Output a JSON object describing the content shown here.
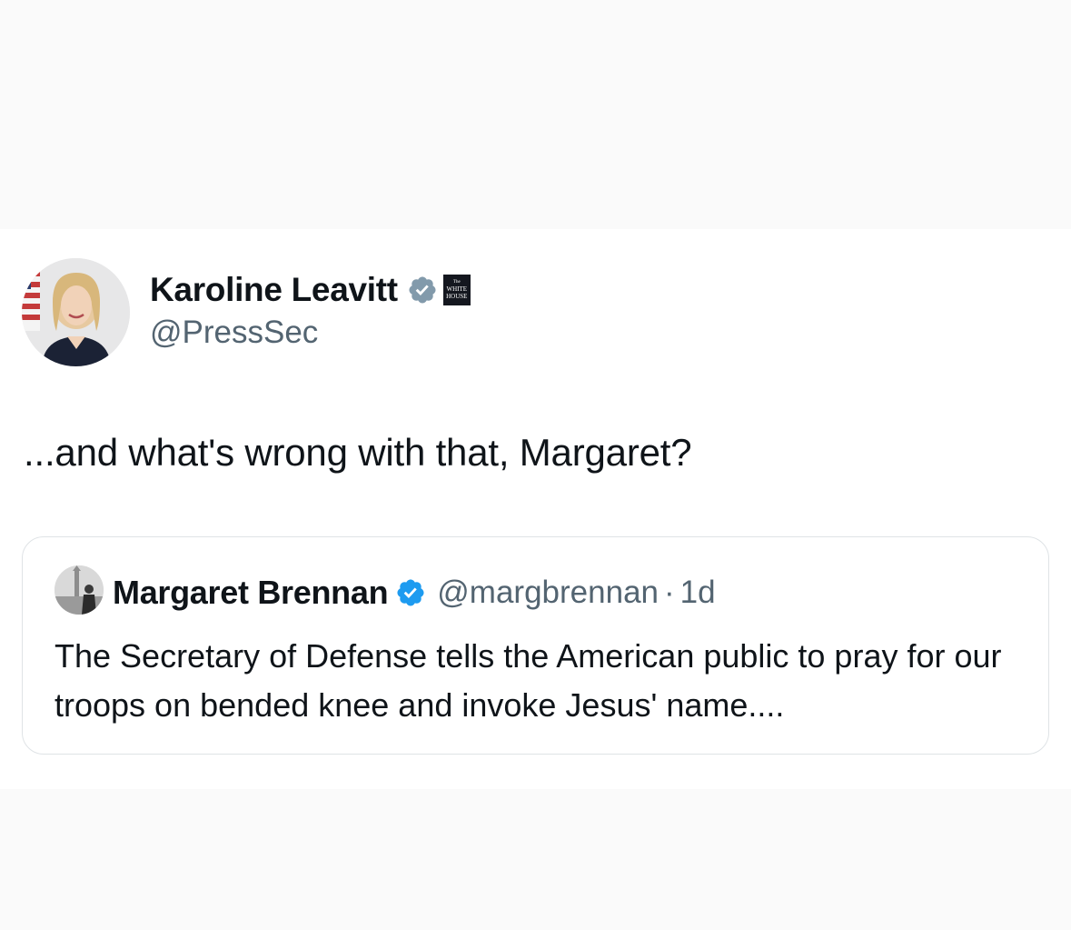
{
  "post": {
    "author": {
      "display_name": "Karoline Leavitt",
      "handle": "@PressSec",
      "verified_badge": "gray-verified-check-icon",
      "affiliation_badge": {
        "icon": "white-house-logo",
        "text_lines": [
          "The",
          "WHITE",
          "HOUSE"
        ]
      },
      "avatar": "avatar-karoline-leavitt"
    },
    "text": "...and what's wrong with that, Margaret?"
  },
  "quoted_post": {
    "author": {
      "display_name": "Margaret Brennan",
      "handle": "@margbrennan",
      "verified_badge": "blue-verified-check-icon",
      "avatar": "avatar-margaret-brennan"
    },
    "separator": "·",
    "time": "1d",
    "text": "The Secretary of Defense tells the American public to pray for our troops on bended knee and invoke Jesus' name...."
  },
  "colors": {
    "text_primary": "#0f1419",
    "text_secondary": "#536471",
    "verified_blue": "#1d9bf0",
    "verified_gray": "#829aab",
    "border": "#dfe3e6",
    "page_bg": "#fbfbfb"
  }
}
